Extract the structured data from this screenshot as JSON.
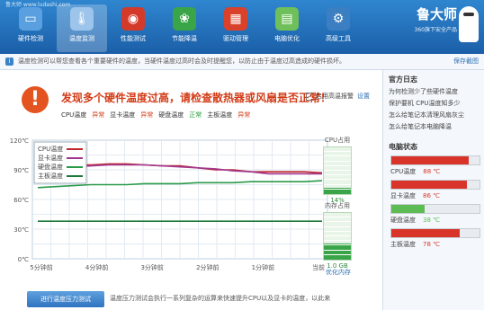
{
  "titlebar": "鲁大师 www.ludashi.com",
  "toolbar": [
    {
      "label": "硬件检测",
      "icon": "monitor-icon",
      "color": "#5aa0e0"
    },
    {
      "label": "温度监测",
      "icon": "thermometer-icon",
      "color": "#9dc4ea",
      "active": true
    },
    {
      "label": "性能测试",
      "icon": "gauge-icon",
      "color": "#d43a2a"
    },
    {
      "label": "节能降温",
      "icon": "leaf-icon",
      "color": "#3aa548"
    },
    {
      "label": "驱动管理",
      "icon": "toolbox-icon",
      "color": "#d9412b"
    },
    {
      "label": "电脑优化",
      "icon": "chart-screen-icon",
      "color": "#6fbf5a"
    },
    {
      "label": "高级工具",
      "icon": "tools-icon",
      "color": "#3b7fc2"
    }
  ],
  "logo": {
    "title": "鲁大师",
    "subtitle": "360旗下安全产品"
  },
  "infobar": {
    "text": "温度检测可以帮您查看各个重要硬件的温度，当硬件温度过高时会及时提醒您，以防止由于温度过高造成的硬件损坏。",
    "save": "保存截图"
  },
  "alert": {
    "headline": "发现多个硬件温度过高，请检查散热器或风扇是否正常！",
    "checkbox_label": "启用高温报警",
    "checkbox_mark": "✓",
    "settings_link": "设置",
    "statuses": [
      {
        "name": "CPU温度",
        "state": "异常",
        "ok": false
      },
      {
        "name": "显卡温度",
        "state": "异常",
        "ok": false
      },
      {
        "name": "硬盘温度",
        "state": "正常",
        "ok": true
      },
      {
        "name": "主板温度",
        "state": "异常",
        "ok": false
      }
    ]
  },
  "chart_data": {
    "type": "line",
    "x": [
      "5分钟前",
      "4分钟前",
      "3分钟前",
      "2分钟前",
      "1分钟前",
      "当前"
    ],
    "ylabels": [
      "120℃",
      "90℃",
      "60℃",
      "30℃",
      "0℃"
    ],
    "ylim": [
      0,
      120
    ],
    "legend": "top-left",
    "series": [
      {
        "name": "CPU温度",
        "color": "#c0272d",
        "values": [
          96,
          96,
          95,
          95,
          96,
          96,
          95,
          94,
          94,
          92,
          90,
          90,
          88,
          88,
          88,
          88,
          87
        ]
      },
      {
        "name": "显卡温度",
        "color": "#a0378f",
        "values": [
          94,
          93,
          93,
          94,
          95,
          95,
          95,
          94,
          93,
          92,
          91,
          89,
          88,
          86,
          86,
          86,
          86
        ]
      },
      {
        "name": "硬盘温度",
        "color": "#2b9a4a",
        "values": [
          72,
          73,
          74,
          75,
          75,
          75,
          76,
          76,
          76,
          77,
          77,
          77,
          78,
          78,
          78,
          78,
          79
        ]
      },
      {
        "name": "主板温度",
        "color": "#1d7a3b",
        "values": [
          38,
          38,
          38,
          38,
          38,
          38,
          38,
          38,
          38,
          38,
          38,
          38,
          38,
          38,
          38,
          38,
          38
        ]
      }
    ]
  },
  "gauges": {
    "cpu": {
      "title": "CPU占用",
      "value": "14%",
      "level": 0.14
    },
    "mem": {
      "title": "内存占用",
      "value": "1.0 GB",
      "level": 0.35
    },
    "optimize": "优化内存"
  },
  "bottom": {
    "button": "进行温度压力测试",
    "text": "温度压力测试会执行一系列复杂的运算来快速提升CPU以及显卡的温度，以此来"
  },
  "official": {
    "title": "官方日志",
    "items": [
      "为何检测少了些硬件温度",
      "保护要机 CPU温度知多少",
      "怎么给笔记本清理风扇灰尘",
      "怎么给笔记本电脑降温"
    ]
  },
  "pc_status": {
    "title": "电脑状态",
    "items": [
      {
        "name": "CPU温度",
        "value": "88 ℃",
        "level": 0.88,
        "color": "#d8342a"
      },
      {
        "name": "显卡温度",
        "value": "86 ℃",
        "level": 0.86,
        "color": "#d8342a"
      },
      {
        "name": "硬盘温度",
        "value": "38 ℃",
        "level": 0.38,
        "color": "#5cbb52"
      },
      {
        "name": "主板温度",
        "value": "78 ℃",
        "level": 0.78,
        "color": "#d8342a"
      }
    ]
  }
}
